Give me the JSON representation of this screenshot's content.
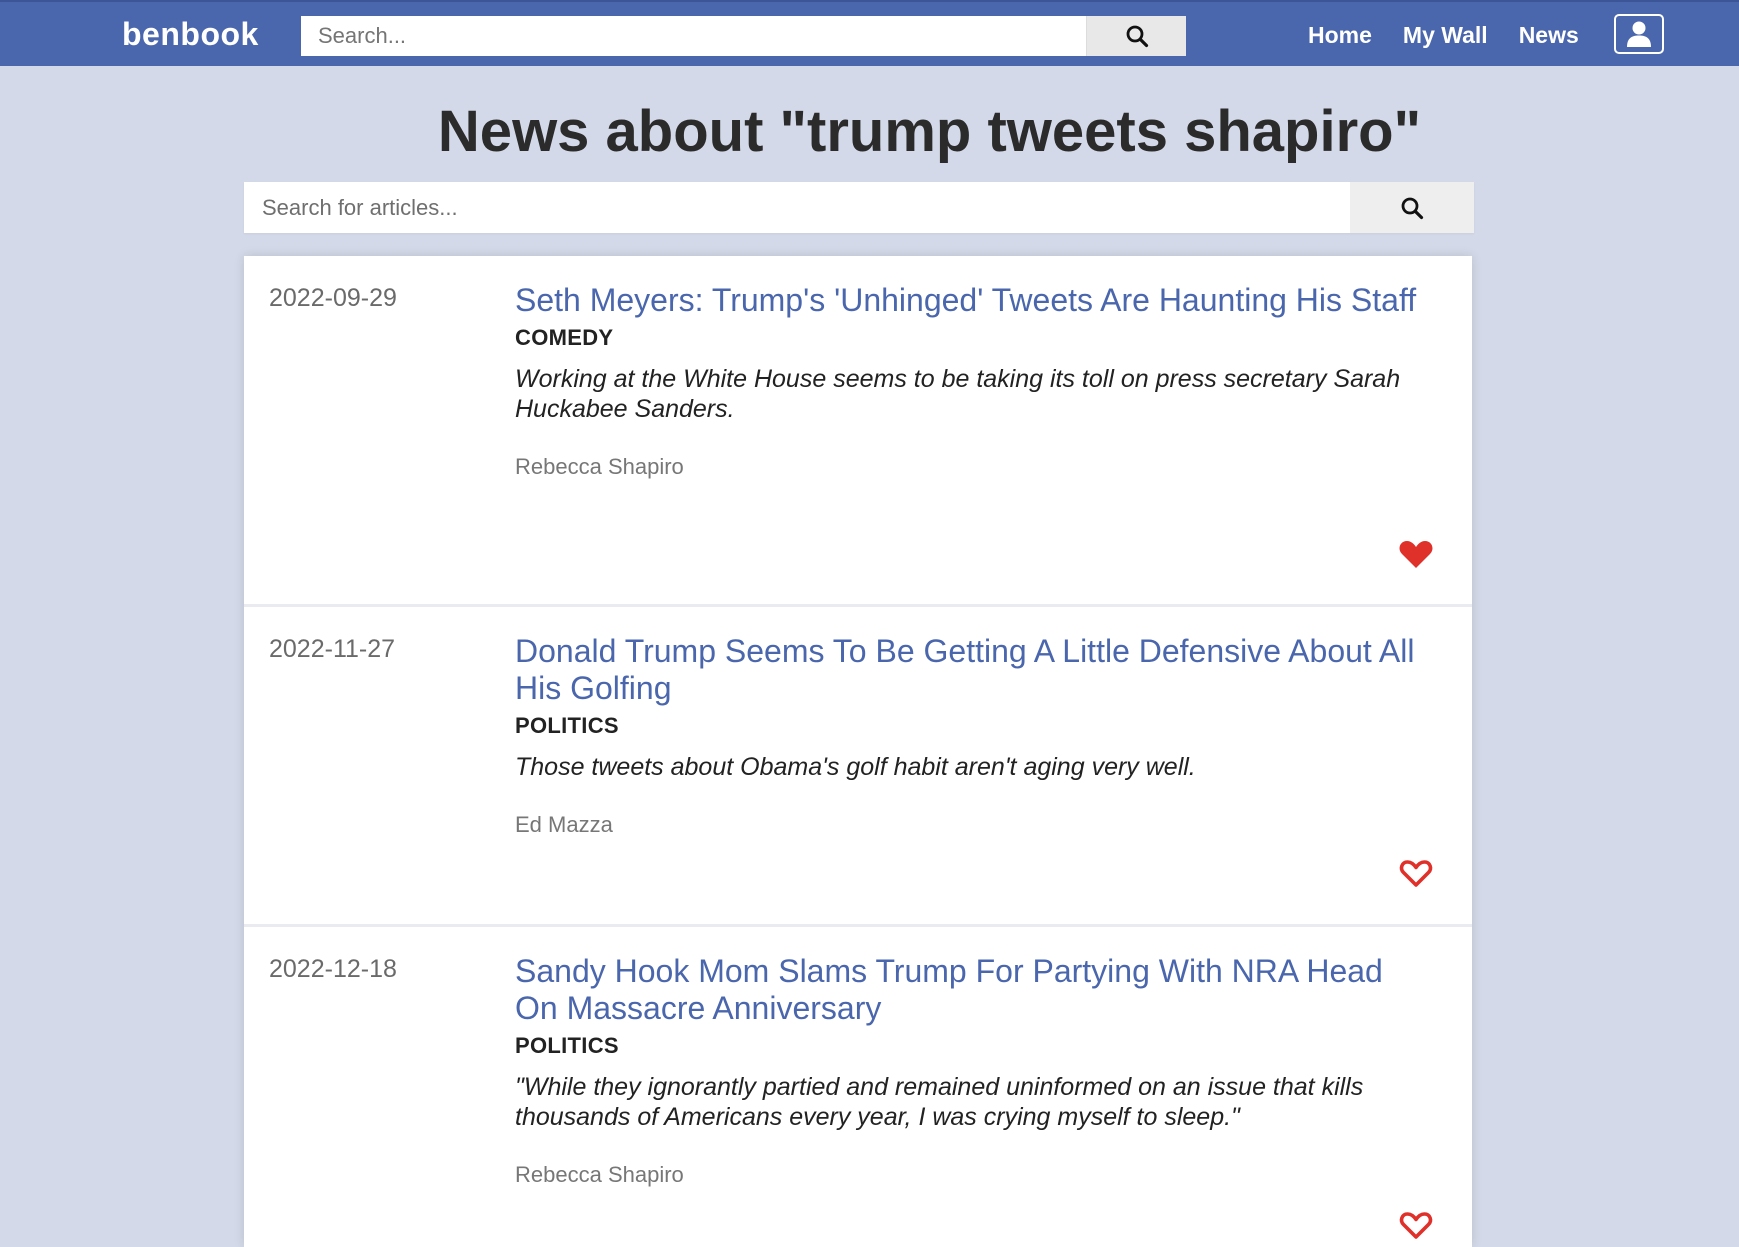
{
  "header": {
    "brand": "benbook",
    "search_placeholder": "Search...",
    "nav": [
      "Home",
      "My Wall",
      "News"
    ]
  },
  "page": {
    "title": "News about \"trump tweets shapiro\"",
    "article_search_placeholder": "Search for articles..."
  },
  "articles": [
    {
      "date": "2022-09-29",
      "title": "Seth Meyers: Trump's 'Unhinged' Tweets Are Haunting His Staff",
      "category": "COMEDY",
      "summary": "Working at the White House seems to be taking its toll on press secretary Sarah Huckabee Sanders.",
      "author": "Rebecca Shapiro",
      "liked": true
    },
    {
      "date": "2022-11-27",
      "title": "Donald Trump Seems To Be Getting A Little Defensive About All His Golfing",
      "category": "POLITICS",
      "summary": "Those tweets about Obama's golf habit aren't aging very well.",
      "author": "Ed Mazza",
      "liked": false
    },
    {
      "date": "2022-12-18",
      "title": "Sandy Hook Mom Slams Trump For Partying With NRA Head On Massacre Anniversary",
      "category": "POLITICS",
      "summary": "\"While they ignorantly partied and remained uninformed on an issue that kills thousands of Americans every year, I was crying myself to sleep.\"",
      "author": "Rebecca Shapiro",
      "liked": false
    }
  ],
  "colors": {
    "brand_blue": "#4a66ad",
    "background": "#d3d9e8",
    "like_red": "#e0302a"
  },
  "icons": {
    "search": "search-icon",
    "user": "user-icon",
    "like": "heart-icon"
  }
}
